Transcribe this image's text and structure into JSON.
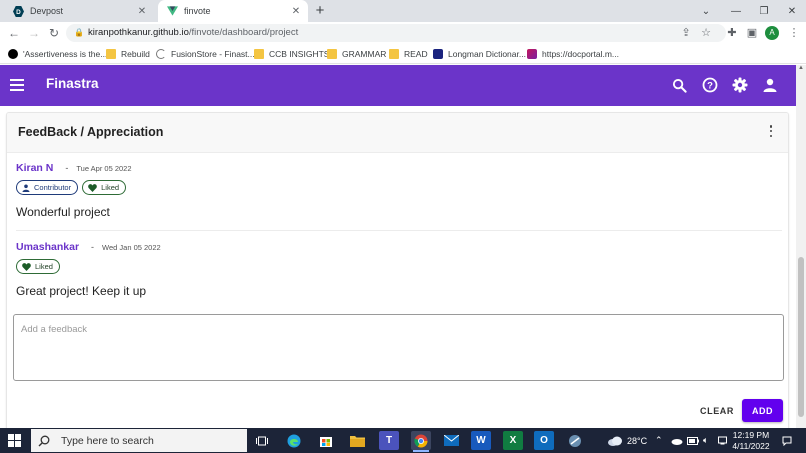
{
  "browser": {
    "tabs": [
      {
        "title": "Devpost",
        "favicon": "devpost-icon",
        "active": false
      },
      {
        "title": "finvote",
        "favicon": "vue-icon",
        "active": true
      }
    ],
    "url_main": "kiranpothkanur.github.io",
    "url_path": "/finvote/dashboard/project",
    "profile_initial": "A",
    "bookmarks": [
      {
        "label": "'Assertiveness is the...",
        "icon": "website-icon"
      },
      {
        "label": "Rebuild",
        "icon": "folder-icon"
      },
      {
        "label": "FusionStore - Finast...",
        "icon": "website-icon"
      },
      {
        "label": "CCB INSIGHTS",
        "icon": "folder-icon"
      },
      {
        "label": "GRAMMAR",
        "icon": "folder-icon"
      },
      {
        "label": "READ",
        "icon": "folder-icon"
      },
      {
        "label": "Longman Dictionar...",
        "icon": "website-icon"
      },
      {
        "label": "https://docportal.m...",
        "icon": "website-icon"
      }
    ]
  },
  "app": {
    "brand": "Finastra",
    "accent_color": "#6b34c9",
    "action_color": "#6200ee"
  },
  "feedback": {
    "title": "FeedBack / Appreciation",
    "comments": [
      {
        "author": "Kiran N",
        "separator": "-",
        "date": "Tue Apr 05 2022",
        "chips": [
          "Contributor",
          "Liked"
        ],
        "text": "Wonderful project"
      },
      {
        "author": "Umashankar",
        "separator": "-",
        "date": "Wed Jan 05 2022",
        "chips": [
          "Liked"
        ],
        "text": "Great project! Keep it up"
      }
    ],
    "input_placeholder": "Add a feedback",
    "clear_label": "CLEAR",
    "add_label": "ADD"
  },
  "taskbar": {
    "search_placeholder": "Type here to search",
    "weather": "28°C",
    "time": "12:19 PM",
    "date": "4/11/2022"
  }
}
